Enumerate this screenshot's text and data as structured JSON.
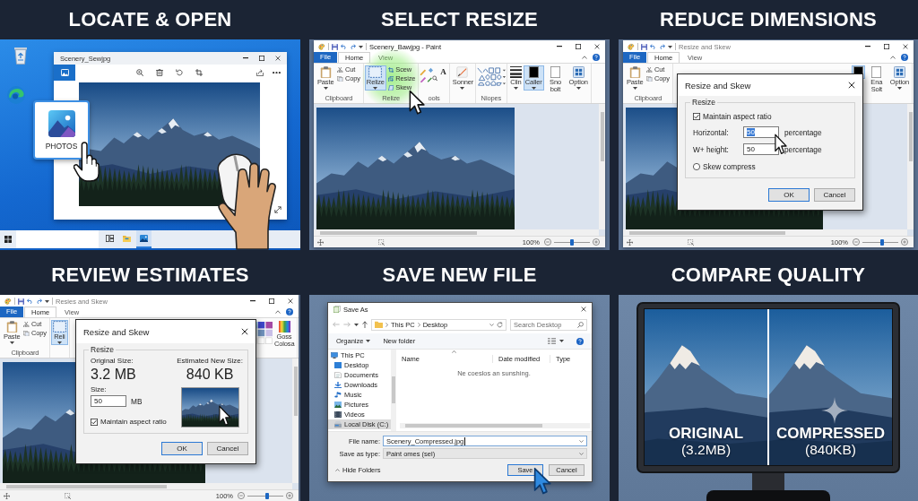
{
  "panels": [
    {
      "kind": "photos",
      "title": "LOCATE & OPEN",
      "viewer": {
        "title": "Scenery_Sewjpg"
      },
      "app_tile": {
        "label": "PHOTOS"
      },
      "taskbar": {
        "items": [
          {
            "kind": "taskview",
            "selected": false
          },
          {
            "kind": "folder",
            "selected": false
          },
          {
            "kind": "photos",
            "selected": true
          }
        ]
      }
    },
    {
      "kind": "paint",
      "title": "SELECT RESIZE",
      "window": {
        "title": "Scenery_Bawjpg - Paint",
        "file_tab": "File",
        "tabs": [
          {
            "label": "Home",
            "selected": true
          },
          {
            "label": "View",
            "selected": false
          }
        ],
        "ribbon": [
          {
            "label": "Clipboard",
            "highlighted": false,
            "items": [
              {
                "kind": "paste",
                "label": "Paste",
                "selected": false
              },
              {
                "kind": "cut",
                "label": "Cut",
                "selected": false
              },
              {
                "kind": "copy",
                "label": "Copy",
                "selected": false
              }
            ]
          },
          {
            "label": "Relize",
            "highlighted": true,
            "items": [
              {
                "kind": "select",
                "label": "Relize",
                "selected": true
              },
              {
                "kind": "crop",
                "label": "Scew",
                "selected": false
              },
              {
                "kind": "resize",
                "label": "Resize",
                "selected": false
              },
              {
                "kind": "skew",
                "label": "Skew",
                "selected": false
              }
            ]
          },
          {
            "label": "ools",
            "highlighted": false,
            "items": [
              {
                "kind": "tools",
                "label": "A",
                "selected": false
              }
            ]
          },
          {
            "highlighted": false,
            "items": [
              {
                "kind": "brush",
                "label": "Sonner",
                "selected": false
              }
            ]
          },
          {
            "label": "Niopes",
            "highlighted": false,
            "items": [
              {
                "kind": "shapes",
                "selected": false
              }
            ]
          },
          {
            "highlighted": false,
            "items": [
              {
                "kind": "size",
                "label": "Clin",
                "selected": false
              },
              {
                "kind": "color1",
                "label": "Caller",
                "selected": true
              },
              {
                "kind": "color2",
                "label": "Sno bolt",
                "selected": false
              },
              {
                "kind": "options",
                "label": "Option",
                "selected": false
              }
            ]
          }
        ],
        "zoom": {
          "reading": "100%",
          "level": 0.5
        }
      }
    },
    {
      "kind": "paint",
      "title": "REDUCE DIMENSIONS",
      "window": {
        "title": "Resize and Skew",
        "file_tab": "File",
        "tabs": [
          {
            "label": "Home",
            "selected": true
          },
          {
            "label": "View",
            "selected": false
          }
        ],
        "ribbon": [
          {
            "label": "Clipboard",
            "highlighted": false,
            "items": [
              {
                "kind": "paste",
                "label": "Paste",
                "selected": false
              },
              {
                "kind": "cut",
                "label": "Cut",
                "selected": false
              },
              {
                "kind": "copy",
                "label": "Copy",
                "selected": false
              }
            ]
          },
          {
            "highlighted": false,
            "items": [
              {
                "kind": "color1",
                "selected": true
              },
              {
                "kind": "color2",
                "label": "Ena Solt",
                "selected": false
              },
              {
                "kind": "options",
                "label": "Option",
                "selected": false
              }
            ]
          }
        ],
        "zoom": {
          "reading": "100%",
          "level": 0.55
        }
      },
      "dialog": {
        "kind": "resize",
        "title": "Resize and Skew",
        "group": "Resize",
        "maintain": {
          "label": "Maintain aspect ratio",
          "checked": true
        },
        "fields": [
          {
            "label": "Horizontal:",
            "value": "50",
            "unit": "percentage",
            "highlighted": true
          },
          {
            "label": "W+ height:",
            "value": "50",
            "unit": "percentage",
            "highlighted": false
          }
        ],
        "skew": {
          "label": "Skew compress",
          "checked": false
        },
        "buttons": [
          {
            "label": "OK",
            "default": true
          },
          {
            "label": "Cancel",
            "default": false
          }
        ]
      }
    },
    {
      "kind": "paint",
      "title": "REVIEW ESTIMATES",
      "window": {
        "title": "Resies and Skew",
        "file_tab": "File",
        "tabs": [
          {
            "label": "Home",
            "selected": true
          },
          {
            "label": "View",
            "selected": false
          }
        ],
        "ribbon": [
          {
            "label": "Clipboard",
            "highlighted": false,
            "items": [
              {
                "kind": "paste",
                "label": "Paste",
                "selected": false
              },
              {
                "kind": "cut",
                "label": "Cut",
                "selected": false
              },
              {
                "kind": "copy",
                "label": "Copy",
                "selected": false
              }
            ]
          },
          {
            "highlighted": false,
            "items": [
              {
                "kind": "select",
                "label": "Reli",
                "selected": true
              }
            ]
          },
          {
            "highlighted": false,
            "items": [
              {
                "kind": "palette",
                "selected": false
              },
              {
                "kind": "editcolors",
                "label": "Goss Colosa",
                "selected": false
              }
            ]
          }
        ],
        "zoom": {
          "reading": "100%",
          "level": 0.55
        }
      },
      "dialog": {
        "kind": "estimate",
        "title": "Resize and Skew",
        "group": "Resize",
        "original": {
          "label": "Original Size:",
          "value": "3.2 MB"
        },
        "estimate": {
          "label": "Estimated New Size:",
          "value": "840 KB"
        },
        "size": {
          "label": "Size:",
          "value": "50",
          "unit": "MB"
        },
        "maintain": {
          "label": "Maintain aspect ratio",
          "checked": true
        },
        "buttons": [
          {
            "label": "OK",
            "default": true
          },
          {
            "label": "Cancel",
            "default": false
          }
        ]
      }
    },
    {
      "kind": "save",
      "title": "SAVE NEW FILE",
      "dialog": {
        "title": "Save As",
        "path": [
          "This PC",
          "Desktop"
        ],
        "search": {
          "placeholder": "Search Desktop"
        },
        "toolbar": [
          {
            "kind": "menu",
            "label": "Organize"
          },
          {
            "kind": "button",
            "label": "New folder"
          }
        ],
        "tree": [
          {
            "kind": "pc",
            "label": "This PC",
            "selected": false,
            "children": [
              {
                "kind": "desktop",
                "label": "Desktop",
                "selected": false
              },
              {
                "kind": "documents",
                "label": "Documents",
                "selected": false
              },
              {
                "kind": "downloads",
                "label": "Downloads",
                "selected": false
              },
              {
                "kind": "music",
                "label": "Music",
                "selected": false
              },
              {
                "kind": "pictures",
                "label": "Pictures",
                "selected": false
              },
              {
                "kind": "videos",
                "label": "Videos",
                "selected": false
              },
              {
                "kind": "disk",
                "label": "Local Disk (C:)",
                "selected": true
              }
            ]
          }
        ],
        "columns": [
          "Name",
          "Date modified",
          "Type"
        ],
        "empty_message": "Ne coeslos an sunshing.",
        "file_name": {
          "label": "File name:",
          "value": "Scenery_Compressed.jpg"
        },
        "file_type": {
          "label": "Save as type:",
          "value": "Paint omes (sel)"
        },
        "hide_folders": "Hide Folders",
        "buttons": [
          {
            "label": "Save",
            "default": true
          },
          {
            "label": "Cancel",
            "default": false
          }
        ]
      }
    },
    {
      "kind": "compare",
      "title": "COMPARE QUALITY",
      "sides": [
        {
          "kind": "original",
          "label": "ORIGINAL",
          "size": "(3.2MB)"
        },
        {
          "kind": "compressed",
          "label": "COMPRESSED",
          "size": "(840KB)"
        }
      ]
    }
  ]
}
